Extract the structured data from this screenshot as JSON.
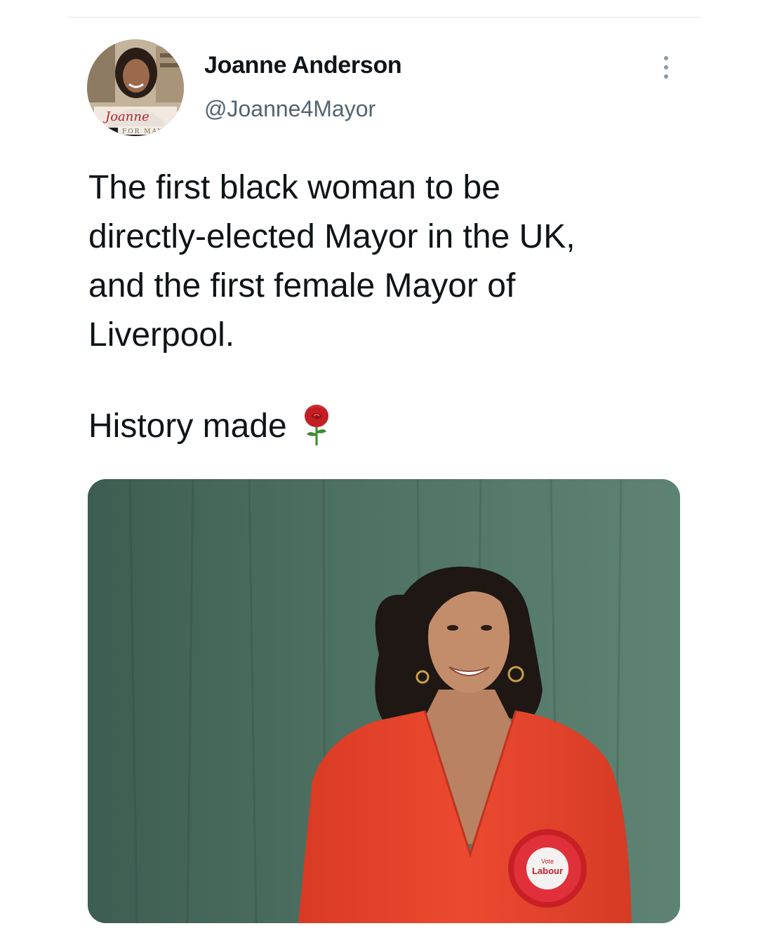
{
  "tweet": {
    "author": {
      "display_name": "Joanne Anderson",
      "handle": "@Joanne4Mayor",
      "avatar_caption": "Joanne FOR MAYOR"
    },
    "text_paragraphs": [
      "The first black woman to be\ndirectly-elected Mayor in the UK,\nand the first female Mayor of\nLiverpool.",
      "History made"
    ],
    "emoji": "rose-icon",
    "photo": {
      "rosette_text_top": "Vote",
      "rosette_text_main": "Labour"
    }
  },
  "colors": {
    "text": "#0f1419",
    "secondary_text": "#536471",
    "curtain": "#4a6b5e",
    "dress": "#e8452c",
    "rosette": "#d8262e"
  }
}
